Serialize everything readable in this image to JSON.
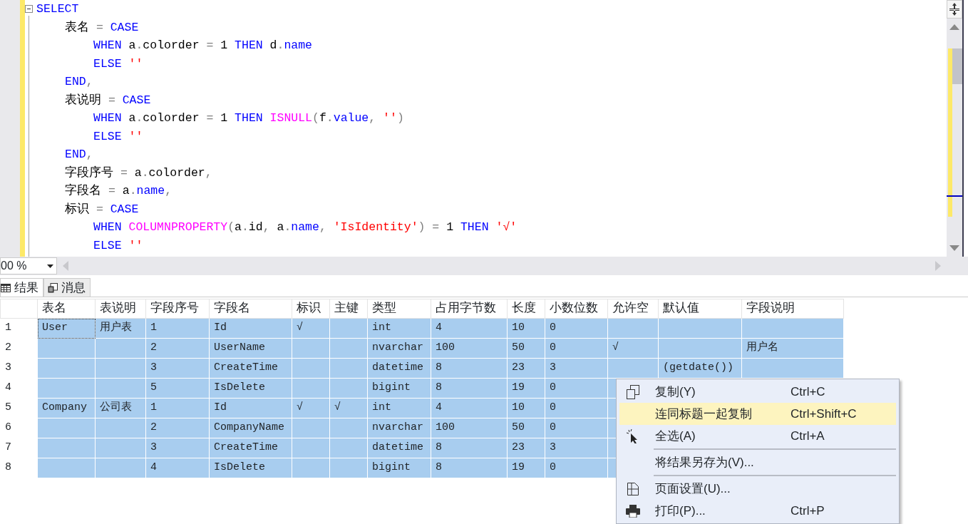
{
  "editor": {
    "lines": [
      {
        "segs": [
          {
            "kind": "k",
            "text": "SELECT"
          }
        ],
        "children": [
          {
            "segs": [
              {
                "kind": "p",
                "text": "表名 "
              },
              {
                "kind": "o",
                "text": "= "
              },
              {
                "kind": "k",
                "text": "CASE"
              }
            ],
            "children": [
              {
                "segs": [
                  {
                    "kind": "k",
                    "text": "WHEN"
                  },
                  {
                    "kind": "p",
                    "text": " a"
                  },
                  {
                    "kind": "o",
                    "text": "."
                  },
                  {
                    "kind": "p",
                    "text": "colorder "
                  },
                  {
                    "kind": "o",
                    "text": "="
                  },
                  {
                    "kind": "p",
                    "text": " 1 "
                  },
                  {
                    "kind": "k",
                    "text": "THEN"
                  },
                  {
                    "kind": "p",
                    "text": " d"
                  },
                  {
                    "kind": "o",
                    "text": "."
                  },
                  {
                    "kind": "k",
                    "text": "name"
                  }
                ]
              },
              {
                "segs": [
                  {
                    "kind": "k",
                    "text": "ELSE "
                  },
                  {
                    "kind": "s",
                    "text": "''"
                  }
                ]
              }
            ]
          },
          {
            "segs": [
              {
                "kind": "k",
                "text": "END"
              },
              {
                "kind": "o",
                "text": ","
              }
            ]
          },
          {
            "segs": [
              {
                "kind": "p",
                "text": "表说明 "
              },
              {
                "kind": "o",
                "text": "= "
              },
              {
                "kind": "k",
                "text": "CASE"
              }
            ],
            "children": [
              {
                "segs": [
                  {
                    "kind": "k",
                    "text": "WHEN"
                  },
                  {
                    "kind": "p",
                    "text": " a"
                  },
                  {
                    "kind": "o",
                    "text": "."
                  },
                  {
                    "kind": "p",
                    "text": "colorder "
                  },
                  {
                    "kind": "o",
                    "text": "="
                  },
                  {
                    "kind": "p",
                    "text": " 1 "
                  },
                  {
                    "kind": "k",
                    "text": "THEN "
                  },
                  {
                    "kind": "f",
                    "text": "ISNULL"
                  },
                  {
                    "kind": "o",
                    "text": "("
                  },
                  {
                    "kind": "p",
                    "text": "f"
                  },
                  {
                    "kind": "o",
                    "text": "."
                  },
                  {
                    "kind": "k",
                    "text": "value"
                  },
                  {
                    "kind": "o",
                    "text": ", "
                  },
                  {
                    "kind": "s",
                    "text": "''"
                  },
                  {
                    "kind": "o",
                    "text": ")"
                  }
                ]
              },
              {
                "segs": [
                  {
                    "kind": "k",
                    "text": "ELSE "
                  },
                  {
                    "kind": "s",
                    "text": "''"
                  }
                ]
              }
            ]
          },
          {
            "segs": [
              {
                "kind": "k",
                "text": "END"
              },
              {
                "kind": "o",
                "text": ","
              }
            ]
          },
          {
            "segs": [
              {
                "kind": "p",
                "text": "字段序号 "
              },
              {
                "kind": "o",
                "text": "="
              },
              {
                "kind": "p",
                "text": " a"
              },
              {
                "kind": "o",
                "text": "."
              },
              {
                "kind": "p",
                "text": "colorder"
              },
              {
                "kind": "o",
                "text": ","
              }
            ]
          },
          {
            "segs": [
              {
                "kind": "p",
                "text": "字段名 "
              },
              {
                "kind": "o",
                "text": "="
              },
              {
                "kind": "p",
                "text": " a"
              },
              {
                "kind": "o",
                "text": "."
              },
              {
                "kind": "k",
                "text": "name"
              },
              {
                "kind": "o",
                "text": ","
              }
            ]
          },
          {
            "segs": [
              {
                "kind": "p",
                "text": "标识 "
              },
              {
                "kind": "o",
                "text": "= "
              },
              {
                "kind": "k",
                "text": "CASE"
              }
            ],
            "children": [
              {
                "segs": [
                  {
                    "kind": "k",
                    "text": "WHEN "
                  },
                  {
                    "kind": "f",
                    "text": "COLUMNPROPERTY"
                  },
                  {
                    "kind": "o",
                    "text": "("
                  },
                  {
                    "kind": "p",
                    "text": "a"
                  },
                  {
                    "kind": "o",
                    "text": "."
                  },
                  {
                    "kind": "p",
                    "text": "id"
                  },
                  {
                    "kind": "o",
                    "text": ", "
                  },
                  {
                    "kind": "p",
                    "text": "a"
                  },
                  {
                    "kind": "o",
                    "text": "."
                  },
                  {
                    "kind": "k",
                    "text": "name"
                  },
                  {
                    "kind": "o",
                    "text": ", "
                  },
                  {
                    "kind": "s",
                    "text": "'IsIdentity'"
                  },
                  {
                    "kind": "o",
                    "text": ") = "
                  },
                  {
                    "kind": "p",
                    "text": "1 "
                  },
                  {
                    "kind": "k",
                    "text": "THEN "
                  },
                  {
                    "kind": "s",
                    "text": "'√'"
                  }
                ]
              },
              {
                "segs": [
                  {
                    "kind": "k",
                    "text": "ELSE "
                  },
                  {
                    "kind": "s",
                    "text": "''"
                  }
                ]
              }
            ]
          }
        ]
      }
    ]
  },
  "zoom": {
    "value": "00 %"
  },
  "result_tabs": [
    {
      "label": "结果",
      "selected": true
    },
    {
      "label": "消息",
      "selected": false
    }
  ],
  "grid": {
    "columns": [
      "表名",
      "表说明",
      "字段序号",
      "字段名",
      "标识",
      "主键",
      "类型",
      "占用字节数",
      "长度",
      "小数位数",
      "允许空",
      "默认值",
      "字段说明"
    ],
    "rows": [
      {
        "number": "1",
        "selected": true,
        "focused": true,
        "cells": [
          "User",
          "用户表",
          "1",
          "Id",
          "√",
          null,
          "int",
          "4",
          "10",
          "0",
          null,
          null,
          null
        ]
      },
      {
        "number": "2",
        "selected": true,
        "focused": false,
        "cells": [
          null,
          null,
          "2",
          "UserName",
          null,
          null,
          "nvarchar",
          "100",
          "50",
          "0",
          "√",
          null,
          "用户名"
        ]
      },
      {
        "number": "3",
        "selected": true,
        "focused": false,
        "cells": [
          null,
          null,
          "3",
          "CreateTime",
          null,
          null,
          "datetime",
          "8",
          "23",
          "3",
          null,
          "(getdate())",
          null
        ]
      },
      {
        "number": "4",
        "selected": true,
        "focused": false,
        "cells": [
          null,
          null,
          "5",
          "IsDelete",
          null,
          null,
          "bigint",
          "8",
          "19",
          "0",
          null,
          null,
          null
        ]
      },
      {
        "number": "5",
        "selected": true,
        "focused": false,
        "cells": [
          "Company",
          "公司表",
          "1",
          "Id",
          "√",
          "√",
          "int",
          "4",
          "10",
          "0",
          null,
          null,
          null
        ]
      },
      {
        "number": "6",
        "selected": true,
        "focused": false,
        "cells": [
          null,
          null,
          "2",
          "CompanyName",
          null,
          null,
          "nvarchar",
          "100",
          "50",
          "0",
          null,
          null,
          null
        ]
      },
      {
        "number": "7",
        "selected": true,
        "focused": false,
        "cells": [
          null,
          null,
          "3",
          "CreateTime",
          null,
          null,
          "datetime",
          "8",
          "23",
          "3",
          null,
          null,
          null
        ]
      },
      {
        "number": "8",
        "selected": true,
        "focused": false,
        "cells": [
          null,
          null,
          "4",
          "IsDelete",
          null,
          null,
          "bigint",
          "8",
          "19",
          "0",
          null,
          null,
          null
        ]
      }
    ]
  },
  "context_menu": {
    "items": [
      {
        "kind": "command",
        "label": "复制(Y)",
        "shortcut": "Ctrl+C",
        "selected": false
      },
      {
        "kind": "command",
        "label": "连同标题一起复制",
        "shortcut": "Ctrl+Shift+C",
        "selected": true
      },
      {
        "kind": "command",
        "label": "全选(A)",
        "shortcut": "Ctrl+A",
        "selected": false
      },
      {
        "kind": "separator"
      },
      {
        "kind": "command",
        "label": "将结果另存为(V)...",
        "selected": false
      },
      {
        "kind": "separator"
      },
      {
        "kind": "command",
        "label": "页面设置(U)...",
        "selected": false
      },
      {
        "kind": "command",
        "label": "打印(P)...",
        "shortcut": "Ctrl+P",
        "selected": false
      }
    ]
  }
}
